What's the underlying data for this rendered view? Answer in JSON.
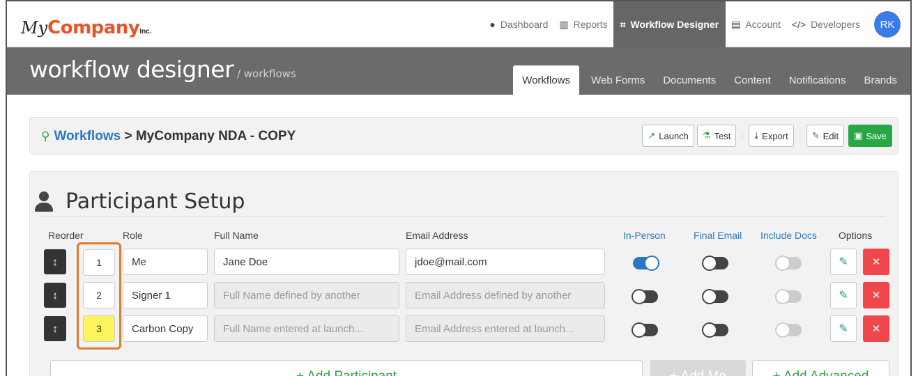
{
  "header": {
    "logo": {
      "my": "My",
      "company": "Company",
      "inc": "Inc."
    },
    "nav": [
      {
        "label": "Dashboard",
        "icon": "palette-icon",
        "glyph": "🎨"
      },
      {
        "label": "Reports",
        "icon": "bar-chart-icon",
        "glyph": "▥"
      },
      {
        "label": "Workflow Designer",
        "icon": "workflow-icon",
        "glyph": "⌗",
        "active": true
      },
      {
        "label": "Account",
        "icon": "account-icon",
        "glyph": "▤"
      },
      {
        "label": "Developers",
        "icon": "code-icon",
        "glyph": "</>"
      }
    ],
    "avatar_initials": "RK"
  },
  "banner": {
    "title": "workflow designer",
    "subtitle": " / workflows",
    "tabs": [
      {
        "label": "Workflows",
        "active": true
      },
      {
        "label": "Web Forms"
      },
      {
        "label": "Documents"
      },
      {
        "label": "Content"
      },
      {
        "label": "Notifications"
      },
      {
        "label": "Brands"
      }
    ]
  },
  "breadcrumb": {
    "link": "Workflows",
    "separator": " > ",
    "current": "MyCompany NDA - COPY"
  },
  "toolbar": {
    "launch": "Launch",
    "test": "Test",
    "export": "Export",
    "edit": "Edit",
    "save": "Save"
  },
  "participants": {
    "title": "Participant Setup",
    "headers": {
      "reorder": "Reorder",
      "role": "Role",
      "full_name": "Full Name",
      "email": "Email Address",
      "in_person": "In-Person",
      "final_email": "Final Email",
      "include_docs": "Include Docs",
      "options": "Options"
    },
    "rows": [
      {
        "order": "1",
        "role": "Me",
        "full_name": "Jane Doe",
        "email": "jdoe@mail.com",
        "in_person": "on",
        "final_email": "off",
        "include_docs": "disabled"
      },
      {
        "order": "2",
        "role": "Signer 1",
        "full_name": "Full Name defined by another",
        "email": "Email Address defined by another",
        "in_person": "off",
        "final_email": "off",
        "include_docs": "disabled"
      },
      {
        "order": "3",
        "role": "Carbon Copy",
        "full_name": "Full Name entered at launch...",
        "email": "Email Address entered at launch...",
        "in_person": "off",
        "final_email": "off",
        "include_docs": "disabled"
      }
    ],
    "actions": {
      "add_participant": "+ Add Participant",
      "add_me": "+ Add Me",
      "add_advanced": "+ Add Advanced"
    }
  },
  "colors": {
    "brand_orange": "#e8542a",
    "link_blue": "#2b78c5",
    "save_green": "#28a745",
    "delete_red": "#f0474d",
    "highlight_yellow": "#fdf35a"
  }
}
